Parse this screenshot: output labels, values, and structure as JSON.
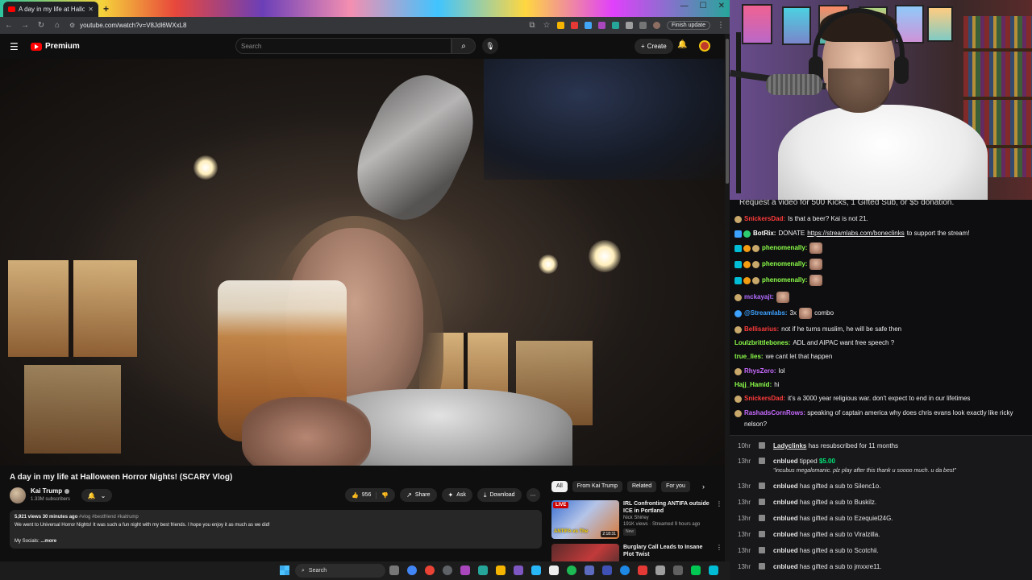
{
  "browser": {
    "tab_title": "A day in my life at Halloween H",
    "new_tab": "+",
    "url": "youtube.com/watch?v=V8Jdl6WXxL8",
    "finish_update": "Finish update"
  },
  "youtube": {
    "brand": "Premium",
    "search_placeholder": "Search",
    "create_label": "Create",
    "video": {
      "title": "A day in my life at Halloween Horror Nights! (SCARY Vlog)",
      "channel": "Kai Trump",
      "subscribers": "1.33M subscribers",
      "likes": "956",
      "share": "Share",
      "ask": "Ask",
      "download": "Download",
      "views_time": "5,921 views  30 minutes ago",
      "tags": "#vlog #bestfriend #kaitrump",
      "description": "We went to Universal Horror Nights! It was such a fun night with my best friends. I hope you enjoy it as much as we did!",
      "socials": "My Socials:",
      "more": "...more"
    },
    "chips": [
      "All",
      "From Kai Trump",
      "Related",
      "For you"
    ],
    "recommendations": [
      {
        "live": "LIVE",
        "thumb_text": "ANTIFA vs The",
        "duration": "2:18:31",
        "title": "IRL Confronting ANTIFA outside ICE in Portland",
        "channel": "Nick Shirley",
        "meta": "191K views · Streamed 9 hours ago",
        "badge": "New"
      },
      {
        "title": "Burglary Call Leads to Insane Plot Twist"
      }
    ]
  },
  "stream": {
    "banner": "Request a video for 500 Kicks, 1 Gifted Sub, or $5 donation.",
    "chat": [
      {
        "user": "SnickersDad:",
        "color": "#ff3b3b",
        "text": "Is that a beer? Kai is not 21."
      },
      {
        "user": "BotRix:",
        "color": "#ffffff",
        "text": "DONATE",
        "link": "https://streamlabs.com/boneclinks",
        "tail": "to support the stream!"
      },
      {
        "user": "phenomenally:",
        "color": "#8dff4a",
        "text": ""
      },
      {
        "user": "phenomenally:",
        "color": "#8dff4a",
        "text": ""
      },
      {
        "user": "phenomenally:",
        "color": "#8dff4a",
        "text": ""
      },
      {
        "user": "mckayajt:",
        "color": "#b36bff",
        "text": ""
      },
      {
        "user": "@Streamlabs:",
        "color": "#3da1ff",
        "text": "3x",
        "tail": "combo"
      },
      {
        "user": "Bellisarius:",
        "color": "#ff3b3b",
        "text": "not if he turns muslim, he will be safe then"
      },
      {
        "user": "Loulzbrittlebones:",
        "color": "#8dff4a",
        "text": "ADL and AIPAC want free speech ?"
      },
      {
        "user": "true_lies:",
        "color": "#8dff4a",
        "text": "we cant let that happen"
      },
      {
        "user": "RhysZero:",
        "color": "#c86bff",
        "text": "lol"
      },
      {
        "user": "Hajj_Hamid:",
        "color": "#8dff4a",
        "text": "hi"
      },
      {
        "user": "SnickersDad:",
        "color": "#ff3b3b",
        "text": "it's a 3000 year religious war. don't expect to end in our lifetimes"
      },
      {
        "user": "RashadsCornRows:",
        "color": "#c86bff",
        "text": "speaking of captain america why does chris evans look exactly like ricky nelson?"
      }
    ],
    "events": [
      {
        "time": "10hr",
        "name": "Ladyclinks",
        "text": "has resubscribed for 11 months"
      },
      {
        "time": "13hr",
        "name": "cnblued",
        "text": "tipped",
        "amount": "$5.00",
        "quote": "\"incubus megalomanic. plz play after this thank u soooo much. u da best\""
      },
      {
        "time": "13hr",
        "name": "cnblued",
        "text": "has gifted a sub to Silenc1o."
      },
      {
        "time": "13hr",
        "name": "cnblued",
        "text": "has gifted a sub to Buskilz."
      },
      {
        "time": "13hr",
        "name": "cnblued",
        "text": "has gifted a sub to Ezequiel24G."
      },
      {
        "time": "13hr",
        "name": "cnblued",
        "text": "has gifted a sub to Viralzilla."
      },
      {
        "time": "13hr",
        "name": "cnblued",
        "text": "has gifted a sub to Scotchii."
      },
      {
        "time": "13hr",
        "name": "cnblued",
        "text": "has gifted a sub to jmxxre11."
      }
    ]
  },
  "taskbar": {
    "search": "Search"
  },
  "colors": {
    "youtube_red": "#ff0000",
    "yt_bg": "#0f0f0f",
    "chat_bg": "#0e0e10",
    "tip_green": "#00e676"
  }
}
